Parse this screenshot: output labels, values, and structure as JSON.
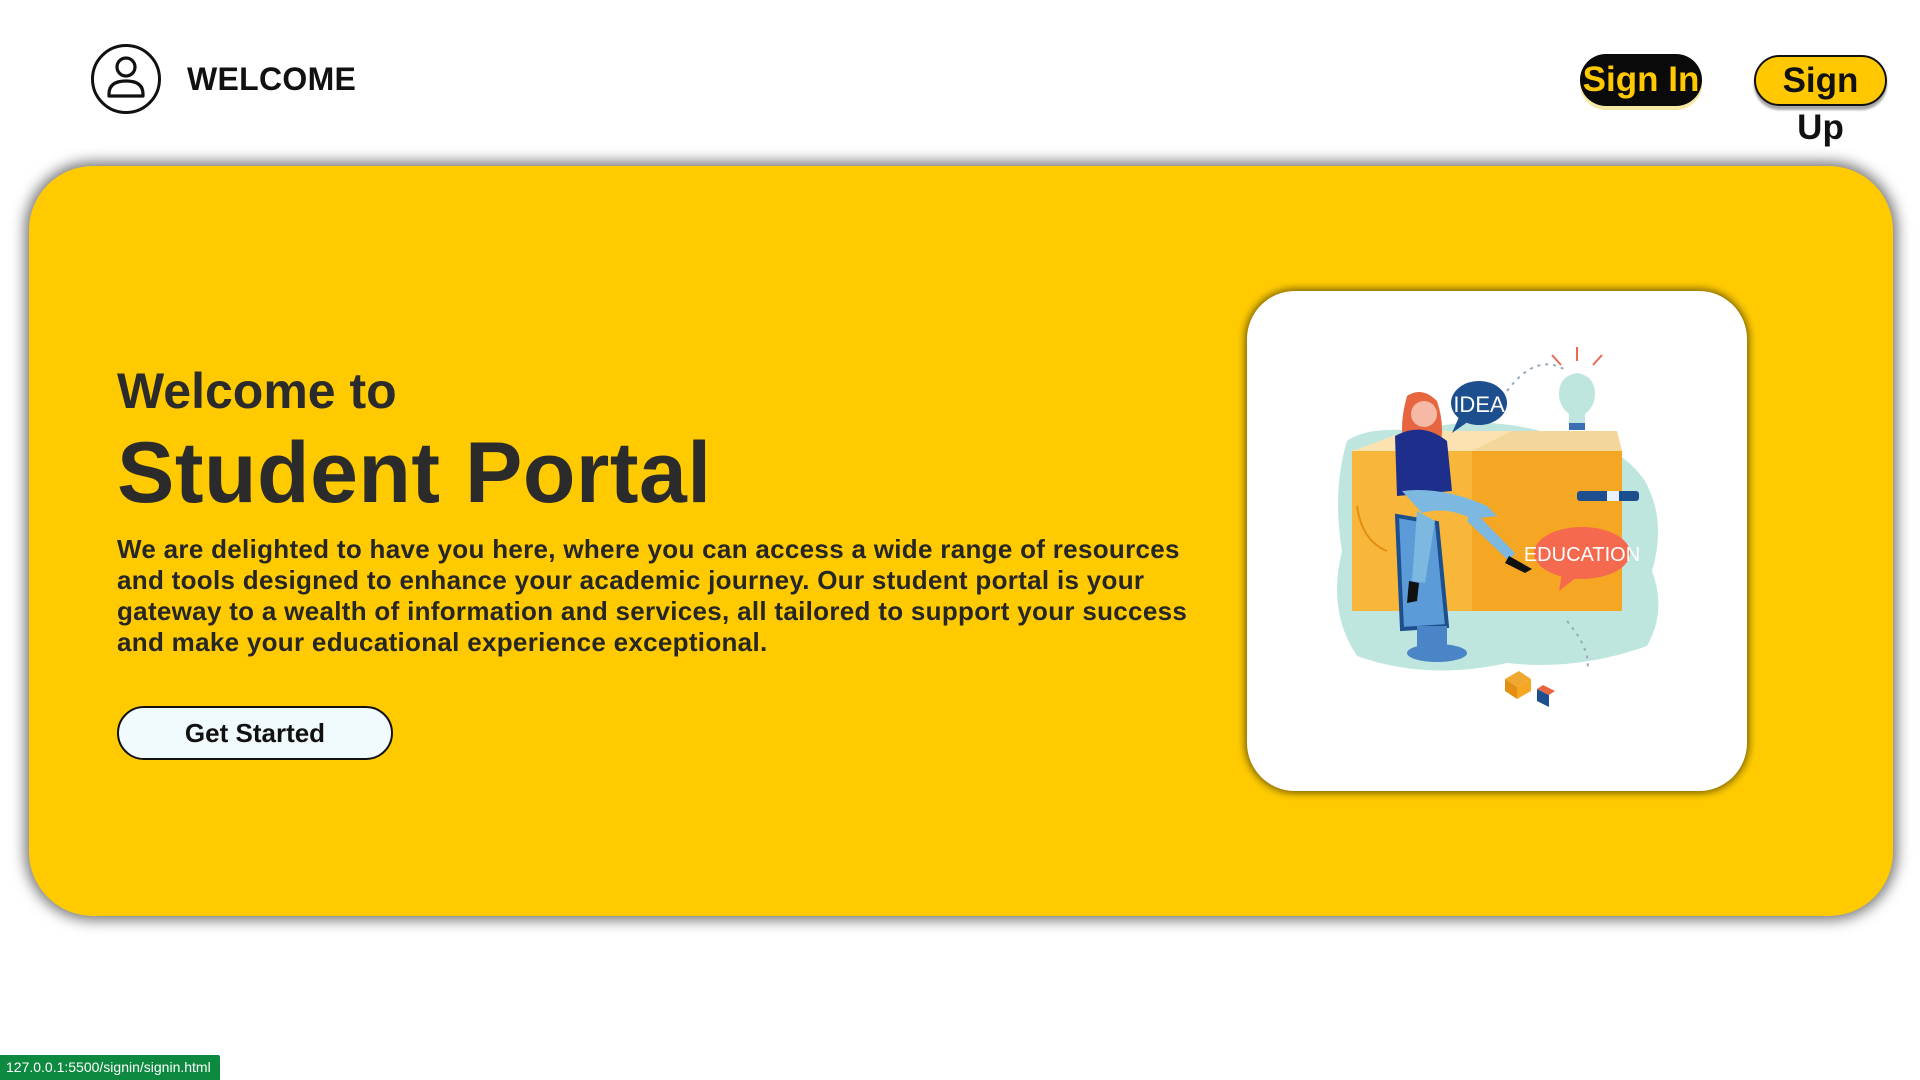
{
  "header": {
    "welcome_label": "WELCOME",
    "user_icon": "user-circle-icon",
    "sign_in_label": "Sign In",
    "sign_up_label": "Sign Up"
  },
  "hero": {
    "subtitle": "Welcome to",
    "title": "Student Portal",
    "description": "We are delighted to have you here, where you can access a wide range of resources and tools designed to enhance your academic journey. Our student portal is your gateway to a wealth of information and services, all tailored to support your success and make your educational experience exceptional.",
    "cta_label": "Get Started",
    "illustration": {
      "icon": "student-education-illustration",
      "bubble_idea": "IDEA",
      "bubble_education": "EDUCATION"
    }
  },
  "status_bar": {
    "url": "127.0.0.1:5500/signin/signin.html"
  },
  "colors": {
    "brand_yellow": "#ffcb00",
    "dark": "#0a0a0a",
    "status_green": "#0d8a3f"
  }
}
